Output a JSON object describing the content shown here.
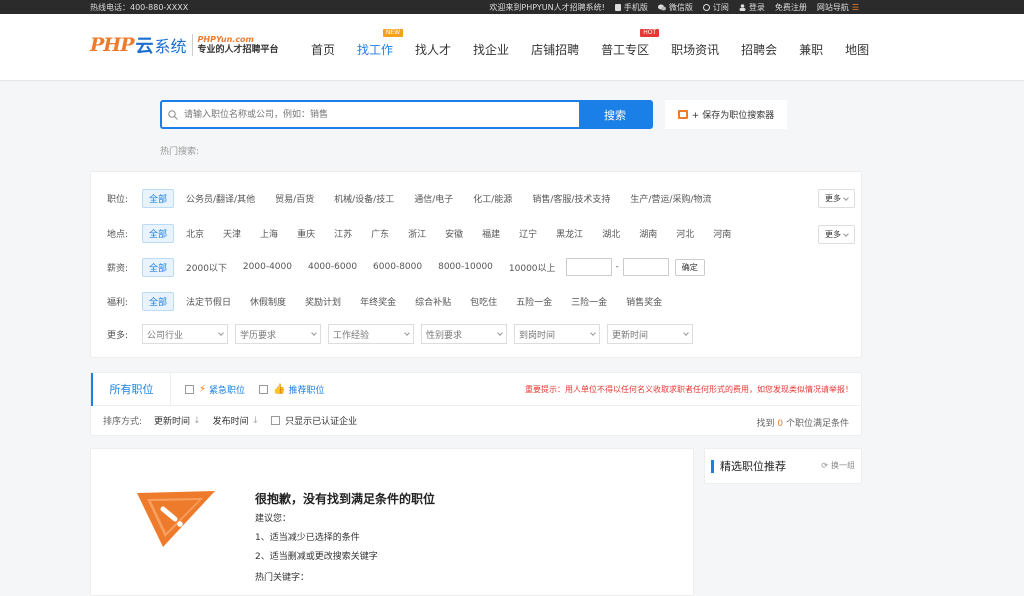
{
  "topbar": {
    "hotline": "热线电话：400-880-XXXX",
    "welcome": "欢迎来到PHPYUN人才招聘系统!",
    "mobile": "手机版",
    "wechat": "微信版",
    "subscribe": "订阅",
    "login": "登录",
    "register": "免费注册",
    "sitenav": "网站导航"
  },
  "logo": {
    "mark": "PHP",
    "cloud": "云",
    "text": "系统",
    "url": "PHPYun.com",
    "slogan": "专业的人才招聘平台"
  },
  "nav": [
    {
      "label": "首页"
    },
    {
      "label": "找工作",
      "badge": "NEW"
    },
    {
      "label": "找人才"
    },
    {
      "label": "找企业"
    },
    {
      "label": "店铺招聘"
    },
    {
      "label": "普工专区",
      "badge": "HOT"
    },
    {
      "label": "职场资讯"
    },
    {
      "label": "招聘会"
    },
    {
      "label": "兼职"
    },
    {
      "label": "地图"
    }
  ],
  "search": {
    "placeholder": "请输入职位名称或公司，例如：销售",
    "button": "搜索",
    "save": "+ 保存为职位搜索器",
    "hot_label": "热门搜索:"
  },
  "filters": {
    "job_label": "职位:",
    "jobs": [
      "全部",
      "公务员/翻译/其他",
      "贸易/百货",
      "机械/设备/技工",
      "通信/电子",
      "化工/能源",
      "销售/客服/技术支持",
      "生产/营运/采购/物流"
    ],
    "location_label": "地点:",
    "locations": [
      "全部",
      "北京",
      "天津",
      "上海",
      "重庆",
      "江苏",
      "广东",
      "浙江",
      "安徽",
      "福建",
      "辽宁",
      "黑龙江",
      "湖北",
      "湖南",
      "河北",
      "河南"
    ],
    "salary_label": "薪资:",
    "salaries": [
      "全部",
      "2000以下",
      "2000-4000",
      "4000-6000",
      "6000-8000",
      "8000-10000",
      "10000以上"
    ],
    "range_sep": "-",
    "confirm": "确定",
    "welfare_label": "福利:",
    "welfare": [
      "全部",
      "法定节假日",
      "休假制度",
      "奖励计划",
      "年终奖金",
      "综合补贴",
      "包吃住",
      "五险一金",
      "三险一金",
      "销售奖金"
    ],
    "more_label": "更多:",
    "more_dropdowns": [
      "公司行业",
      "学历要求",
      "工作经验",
      "性别要求",
      "到岗时间",
      "更新时间"
    ],
    "more_btn": "更多"
  },
  "tabs": {
    "all": "所有职位",
    "urgent": "紧急职位",
    "recommend": "推荐职位",
    "notice": "重要提示：用人单位不得以任何名义收取求职者任何形式的费用，如您发现类似情况请举报！"
  },
  "sort": {
    "label": "排序方式:",
    "update": "更新时间",
    "publish": "发布时间",
    "verified": "只显示已认证企业",
    "found_prefix": "找到",
    "found_count": "0",
    "found_suffix": "个职位满足条件"
  },
  "result": {
    "title": "很抱歉，没有找到满足条件的职位",
    "suggest": "建议您：",
    "tip1": "1、适当减少已选择的条件",
    "tip2": "2、适当删减或更改搜索关键字",
    "hot": "热门关键字："
  },
  "side": {
    "title": "精选职位推荐",
    "swap": "换一组"
  },
  "colors": {
    "accent": "#1a80e8",
    "orange": "#ee7b2c",
    "alert": "#e53935"
  }
}
